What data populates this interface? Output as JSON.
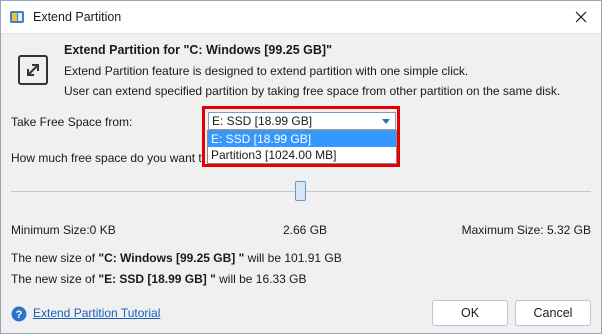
{
  "window": {
    "title": "Extend Partition"
  },
  "header": {
    "title": "Extend Partition for \"C: Windows [99.25 GB]\"",
    "description_line1": "Extend Partition feature is designed to extend partition with one simple click.",
    "description_line2": "User can extend specified partition by taking free space from other partition on the same disk."
  },
  "take_free_space": {
    "label": "Take Free Space from:",
    "selected": "E: SSD [18.99 GB]",
    "options": [
      "E: SSD [18.99 GB]",
      "Partition3 [1024.00 MB]"
    ]
  },
  "how_much_label": "How much free space do you want to take:",
  "slider": {
    "position_fraction": 0.5,
    "min_label": "Minimum Size:0 KB",
    "current_label": "2.66 GB",
    "max_label": "Maximum Size: 5.32 GB"
  },
  "new_size": {
    "line1_prefix": "The new size of ",
    "line1_partition": "\"C: Windows [99.25 GB] \"",
    "line1_suffix": " will be 101.91 GB",
    "line2_prefix": "The new size of ",
    "line2_partition": "\"E: SSD [18.99 GB] \"",
    "line2_suffix": " will be 16.33 GB"
  },
  "footer": {
    "tutorial_link": "Extend Partition Tutorial",
    "ok_label": "OK",
    "cancel_label": "Cancel"
  },
  "colors": {
    "highlight_border": "#e30000",
    "selected_item": "#3399ff",
    "link": "#1a5fb4"
  }
}
